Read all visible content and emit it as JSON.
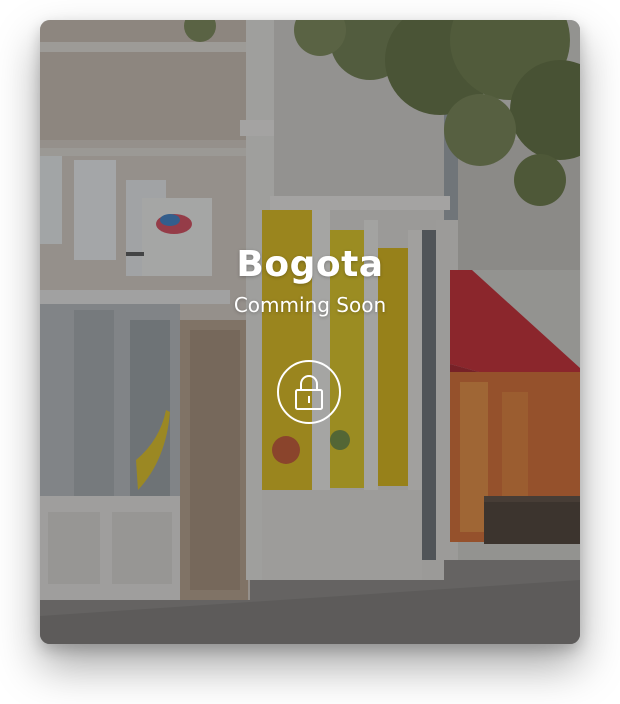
{
  "card": {
    "title": "Bogota",
    "subtitle": "Comming Soon",
    "lock_icon": "lock-icon"
  },
  "colors": {
    "text": "#ffffff",
    "awning": "#c0262c",
    "window_glow": "#e8c21c",
    "overlay": "rgba(40,42,46,0.38)"
  }
}
